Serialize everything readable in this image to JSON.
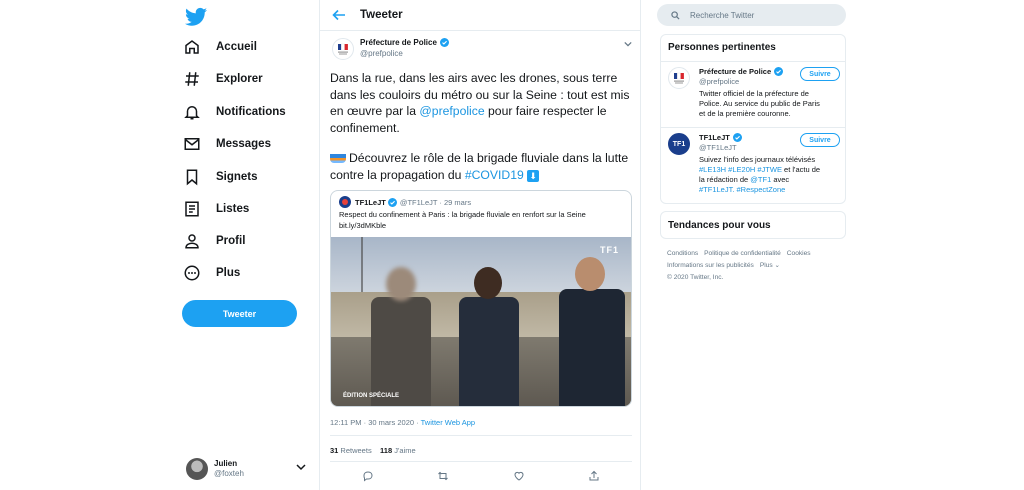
{
  "nav": {
    "items": [
      {
        "label": "Accueil",
        "icon": "home-icon"
      },
      {
        "label": "Explorer",
        "icon": "hashtag-icon"
      },
      {
        "label": "Notifications",
        "icon": "bell-icon"
      },
      {
        "label": "Messages",
        "icon": "envelope-icon"
      },
      {
        "label": "Signets",
        "icon": "bookmark-icon"
      },
      {
        "label": "Listes",
        "icon": "list-icon"
      },
      {
        "label": "Profil",
        "icon": "person-icon"
      },
      {
        "label": "Plus",
        "icon": "more-circle-icon"
      }
    ],
    "tweet_button": "Tweeter"
  },
  "account": {
    "name": "Julien",
    "handle": "@foxteh"
  },
  "header": {
    "title": "Tweeter"
  },
  "tweet": {
    "author_name": "Préfecture de Police",
    "author_handle": "@prefpolice",
    "text_p1_a": "Dans la rue, dans les airs avec les drones, sous terre dans les couloirs du métro ou sur la Seine : tout est mis en œuvre par la ",
    "text_p1_mention": "@prefpolice",
    "text_p1_b": " pour faire respecter le confinement.",
    "text_p2_a": "Découvrez le rôle de la brigade fluviale dans la lutte contre la propagation du ",
    "text_p2_hashtag": "#COVID19",
    "quoted": {
      "name": "TF1LeJT",
      "handle": "@TF1LeJT · 29 mars",
      "text": "Respect du confinement à Paris : la brigade fluviale en renfort sur la Seine bit.ly/3dMKble",
      "media_logo": "TF1",
      "media_caption": "ÉDITION SPÉCIALE"
    },
    "timestamp": "12:11 PM · 30 mars 2020 · ",
    "source": "Twitter Web App",
    "retweets_count": "31",
    "retweets_label": " Retweets",
    "likes_count": "118",
    "likes_label": " J'aime"
  },
  "search": {
    "placeholder": "Recherche Twitter"
  },
  "relevant": {
    "title": "Personnes pertinentes",
    "people": [
      {
        "name": "Préfecture de Police",
        "handle": "@prefpolice",
        "bio": "Twitter officiel de la préfecture de Police. Au service du public de Paris et de la première couronne.",
        "follow": "Suivre"
      },
      {
        "name": "TF1LeJT",
        "handle": "@TF1LeJT",
        "bio_a": "Suivez l'info des journaux télévisés ",
        "bio_tags": "#LE13H #LE20H #JTWE",
        "bio_b": " et l'actu de la rédaction de ",
        "bio_mention": "@TF1",
        "bio_c": " avec ",
        "bio_tags2": "#TF1LeJT. #RespectZone",
        "follow": "Suivre",
        "avatar_text": "TF1"
      }
    ]
  },
  "trends": {
    "title": "Tendances pour vous"
  },
  "footer": {
    "links": [
      "Conditions",
      "Politique de confidentialité",
      "Cookies",
      "Informations sur les publicités",
      "Plus ⌄"
    ],
    "copyright": "© 2020 Twitter, Inc."
  },
  "colors": {
    "accent": "#1da1f2",
    "text": "#14171a",
    "secondary": "#657786",
    "border": "#e6ecf0"
  }
}
